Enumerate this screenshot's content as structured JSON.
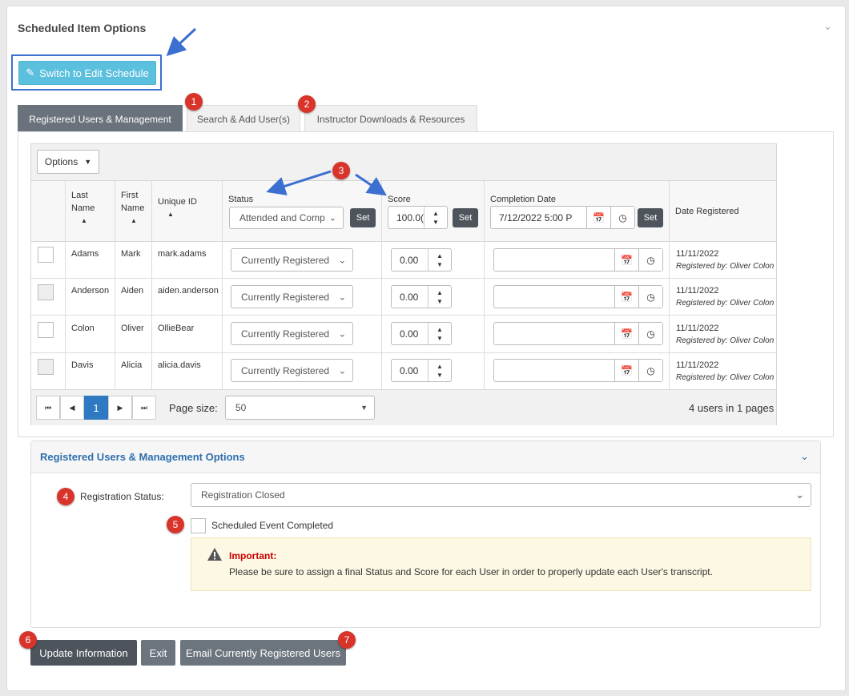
{
  "page": {
    "title": "Scheduled Item Options"
  },
  "switch_button": {
    "label": "Switch to Edit Schedule"
  },
  "tabs": [
    {
      "label": "Registered Users & Management"
    },
    {
      "label": "Search & Add User(s)"
    },
    {
      "label": "Instructor Downloads & Resources"
    }
  ],
  "grid": {
    "options_label": "Options",
    "columns": {
      "last_name_1": "Last",
      "last_name_2": "Name",
      "first_name_1": "First",
      "first_name_2": "Name",
      "unique_id": "Unique ID",
      "status": "Status",
      "score": "Score",
      "completion_date": "Completion Date",
      "date_registered": "Date Registered"
    },
    "bulk": {
      "status_value": "Attended and Comp",
      "score_value": "100.0(",
      "completion_value": "7/12/2022 5:00 P",
      "set_label": "Set"
    },
    "rows": [
      {
        "last": "Adams",
        "first": "Mark",
        "id": "mark.adams",
        "status": "Currently Registered",
        "score": "0.00",
        "date": "11/11/2022",
        "reg_by": "Registered by: Oliver Colon"
      },
      {
        "last": "Anderson",
        "first": "Aiden",
        "id": "aiden.anderson",
        "status": "Currently Registered",
        "score": "0.00",
        "date": "11/11/2022",
        "reg_by": "Registered by: Oliver Colon"
      },
      {
        "last": "Colon",
        "first": "Oliver",
        "id": "OllieBear",
        "status": "Currently Registered",
        "score": "0.00",
        "date": "11/11/2022",
        "reg_by": "Registered by: Oliver Colon"
      },
      {
        "last": "Davis",
        "first": "Alicia",
        "id": "alicia.davis",
        "status": "Currently Registered",
        "score": "0.00",
        "date": "11/11/2022",
        "reg_by": "Registered by: Oliver Colon"
      }
    ],
    "pager": {
      "current_page": "1",
      "page_size_label": "Page size:",
      "page_size": "50",
      "summary": "4 users in 1 pages"
    }
  },
  "options_panel": {
    "title": "Registered Users & Management Options",
    "registration_status_label": "Registration Status:",
    "registration_status_value": "Registration Closed",
    "completed_label": "Scheduled Event Completed",
    "important_title": "Important:",
    "important_text": "Please be sure to assign a final Status and Score for each User in order to properly update each User's transcript."
  },
  "actions": {
    "update": "Update Information",
    "exit": "Exit",
    "email": "Email Currently Registered Users"
  },
  "callouts": [
    "1",
    "2",
    "3",
    "4",
    "5",
    "6",
    "7"
  ],
  "colors": {
    "accent": "#5bc0de",
    "dark_button": "#4d545b",
    "badge": "#d9342b",
    "link_blue": "#2e6fad",
    "callout_arrow": "#3b6fd0"
  }
}
